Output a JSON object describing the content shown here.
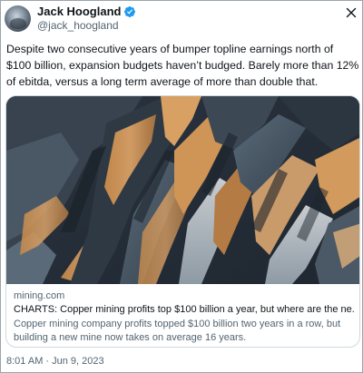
{
  "author": {
    "display_name": "Jack Hoogland",
    "handle": "@jack_hoogland",
    "avatar_icon": "avatar-photo",
    "verified_icon": "verified-badge-icon",
    "verified_color": "#1d9bf0"
  },
  "tweet": {
    "text": "Despite two consecutive years of bumper topline earnings north of $100 billion, expansion budgets haven’t budged. Barely more than 12% of ebitda, versus a long term average of more than double that."
  },
  "link_card": {
    "image_icon": "open-pit-mine-photo",
    "domain": "mining.com",
    "title": "CHARTS: Copper mining profits top $100 billion a year, but where are the ne...",
    "description": "Copper mining company profits topped $100 billion two years in a row, but building a new mine now takes on average 16 years."
  },
  "footer": {
    "timestamp": "8:01 AM · Jun 9, 2023"
  },
  "controls": {
    "close_icon": "close-icon"
  },
  "colors": {
    "text_primary": "#0f1419",
    "text_secondary": "#536471",
    "border": "#cfd9de"
  }
}
